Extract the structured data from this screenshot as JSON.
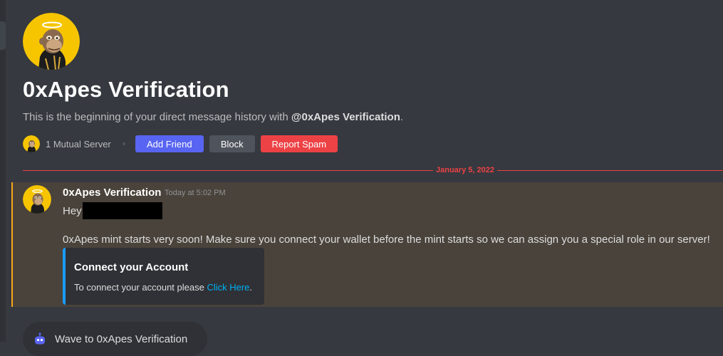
{
  "profile": {
    "name": "0xApes Verification",
    "intro_prefix": "This is the beginning of your direct message history with ",
    "intro_handle": "@0xApes Verification",
    "intro_suffix": ".",
    "mutual_servers": "1 Mutual Server",
    "buttons": {
      "add_friend": "Add Friend",
      "block": "Block",
      "report_spam": "Report Spam"
    }
  },
  "divider": {
    "date": "January 5, 2022"
  },
  "message": {
    "author": "0xApes Verification",
    "timestamp": "Today at 5:02 PM",
    "greeting": "Hey",
    "body": "0xApes mint starts very soon! Make sure you connect your wallet before the mint starts so we can assign you a special role in our server!",
    "embed": {
      "title": "Connect your Account",
      "description_prefix": "To connect your account please ",
      "link_text": "Click Here",
      "description_suffix": ".",
      "accent_color": "#1a9cf5"
    }
  },
  "wave": {
    "label": "Wave to 0xApes Verification"
  },
  "colors": {
    "background": "#36393f",
    "mention_highlight": "#4a433b",
    "mention_bar": "#faa81a",
    "brand": "#5865f2",
    "danger": "#ed4245",
    "link": "#00aff4"
  }
}
